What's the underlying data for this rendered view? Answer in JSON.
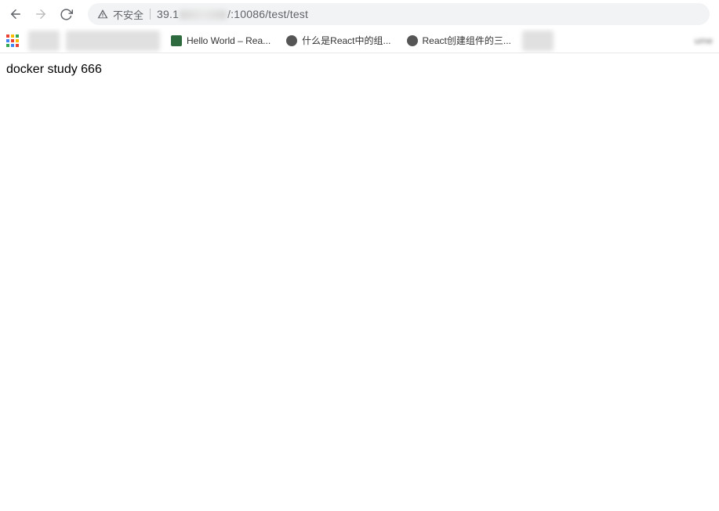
{
  "toolbar": {
    "security_label": "不安全",
    "url_prefix": "39.1",
    "url_suffix": "/:10086/test/test"
  },
  "bookmarks": {
    "item3_label": "Hello World – Rea...",
    "item4_label": "什么是React中的组...",
    "item5_label": "React创建组件的三...",
    "trailing": "ume"
  },
  "page": {
    "body_text": "docker study 666"
  }
}
